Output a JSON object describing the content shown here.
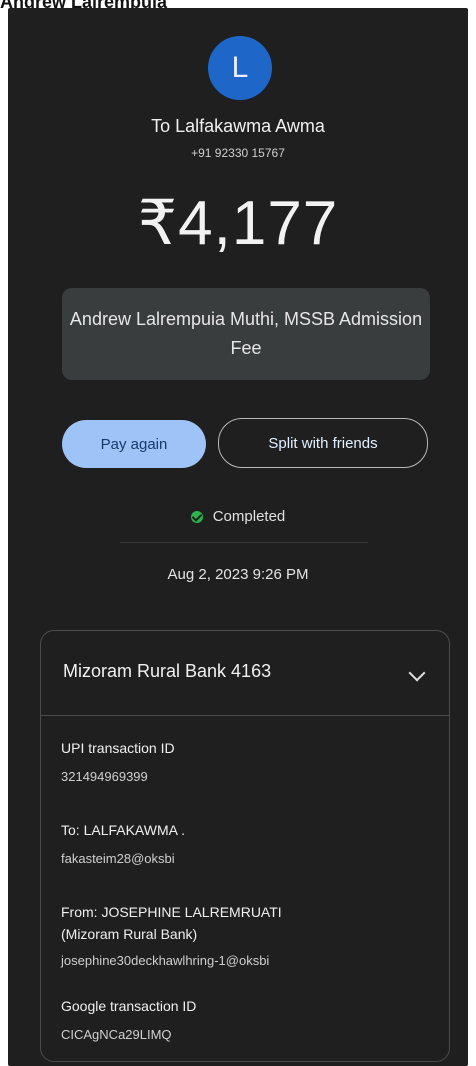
{
  "top_caption": "Andrew Lalrempuia",
  "recipient": {
    "avatar_letter": "L",
    "to_name": "To Lalfakawma Awma",
    "phone": "+91 92330 15767"
  },
  "amount": "₹4,177",
  "note": "Andrew Lalrempuia Muthi, MSSB Admission Fee",
  "actions": {
    "pay_again": "Pay again",
    "split": "Split with friends"
  },
  "status": {
    "label": "Completed",
    "color": "#2fb34e"
  },
  "datetime": "Aug 2, 2023 9:26 PM",
  "details": {
    "bank": "Mizoram Rural Bank 4163",
    "upi_label": "UPI transaction ID",
    "upi_value": "321494969399",
    "to_label": "To: LALFAKAWMA .",
    "to_value": "fakasteim28@oksbi",
    "from_label_line1": "From: JOSEPHINE LALREMRUATI",
    "from_label_line2": "(Mizoram Rural Bank)",
    "from_value": "josephine30deckhawlhring-1@oksbi",
    "google_label": "Google transaction ID",
    "google_value": "CICAgNCa29LIMQ"
  },
  "colors": {
    "background": "#1f1f1f",
    "avatar": "#1e66c7",
    "pay_again_bg": "#9ec3f6"
  }
}
